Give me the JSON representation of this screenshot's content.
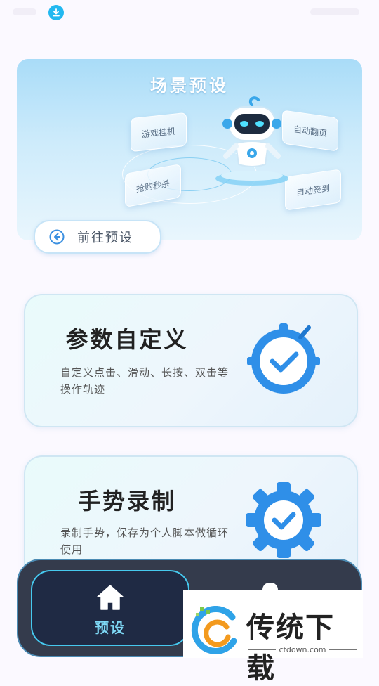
{
  "hero": {
    "title": "场景预设",
    "cards": [
      "游戏挂机",
      "自动翻页",
      "抢购秒杀",
      "自动签到"
    ],
    "button_label": "前往预设"
  },
  "features": [
    {
      "title": "参数自定义",
      "desc": "自定义点击、滑动、长按、双击等操作轨迹"
    },
    {
      "title": "手势录制",
      "desc": "录制手势，保存为个人脚本做循环使用"
    }
  ],
  "bottom_nav": {
    "home_label": "预设"
  },
  "watermark": {
    "brand": "传统下载",
    "url": "ctdown.com"
  },
  "colors": {
    "accent": "#2b9af0",
    "nav_bg": "#343b4c",
    "nav_active_border": "#46c9ef",
    "status_download": "#22b8f0"
  }
}
